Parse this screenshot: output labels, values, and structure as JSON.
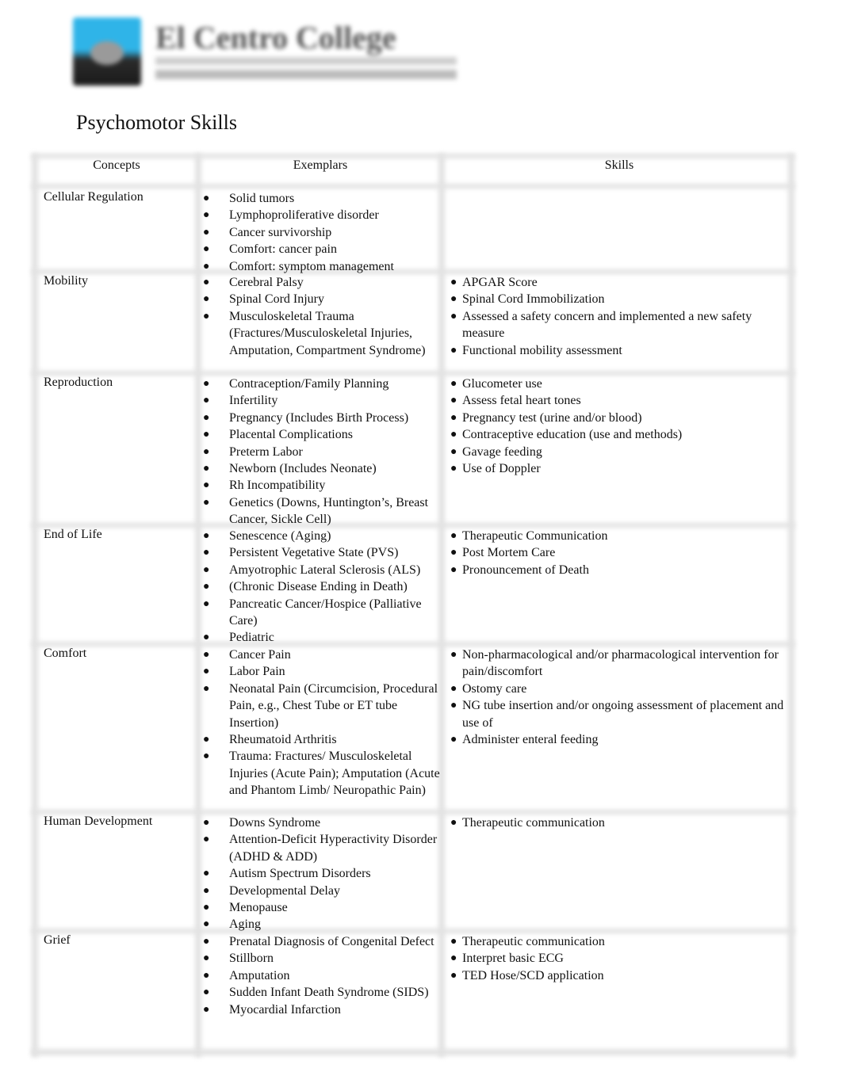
{
  "header": {
    "logo": {
      "name": "El Centro College",
      "subtitle": "DALLAS COUNTY COMMUNITY COLLEGES"
    },
    "title": "Psychomotor Skills"
  },
  "table": {
    "columns": [
      "Concepts",
      "Exemplars",
      "Skills"
    ],
    "rows": [
      {
        "concept": "Cellular Regulation",
        "exemplars": [
          "Solid tumors",
          "Lymphoproliferative disorder",
          "Cancer survivorship",
          "Comfort: cancer pain",
          "Comfort: symptom management"
        ],
        "skills": []
      },
      {
        "concept": "Mobility",
        "exemplars": [
          "Cerebral Palsy",
          "Spinal Cord Injury",
          "Musculoskeletal Trauma (Fractures/Musculoskeletal Injuries, Amputation, Compartment Syndrome)"
        ],
        "skills": [
          "APGAR Score",
          "Spinal Cord Immobilization",
          "Assessed a safety concern and implemented a  new safety measure",
          "Functional mobility assessment"
        ]
      },
      {
        "concept": "Reproduction",
        "exemplars": [
          "Contraception/Family Planning",
          "Infertility",
          "Pregnancy (Includes Birth Process)",
          "Placental Complications",
          "Preterm Labor",
          "Newborn (Includes Neonate)",
          "Rh Incompatibility",
          "Genetics (Downs, Huntington’s, Breast Cancer, Sickle Cell)"
        ],
        "skills": [
          "Glucometer use",
          "Assess fetal heart tones",
          "Pregnancy test (urine and/or blood)",
          "Contraceptive education (use and methods)",
          "Gavage feeding",
          "Use of Doppler"
        ]
      },
      {
        "concept": "End of Life",
        "exemplars": [
          "Senescence (Aging)",
          "Persistent Vegetative State (PVS)",
          "Amyotrophic Lateral Sclerosis (ALS)",
          "(Chronic Disease Ending in Death)",
          "Pancreatic Cancer/Hospice (Palliative Care)",
          "Pediatric"
        ],
        "skills": [
          "Therapeutic Communication",
          "Post Mortem Care",
          "Pronouncement of Death"
        ]
      },
      {
        "concept": "Comfort",
        "exemplars": [
          "Cancer Pain",
          "Labor Pain",
          "Neonatal Pain (Circumcision, Procedural Pain, e.g., Chest Tube or ET tube Insertion)",
          "Rheumatoid Arthritis",
          "Trauma:  Fractures/ Musculoskeletal Injuries (Acute Pain); Amputation (Acute and Phantom Limb/ Neuropathic Pain)"
        ],
        "skills": [
          "Non-pharmacological and/or pharmacological intervention for pain/discomfort",
          "Ostomy care",
          "NG tube insertion and/or ongoing assessment of placement and use of",
          "Administer enteral feeding"
        ]
      },
      {
        "concept": "Human Development",
        "exemplars": [
          "Downs Syndrome",
          "Attention-Deficit Hyperactivity Disorder (ADHD & ADD)",
          "Autism Spectrum Disorders",
          "Developmental Delay",
          "Menopause",
          "Aging"
        ],
        "skills": [
          "Therapeutic communication"
        ]
      },
      {
        "concept": "Grief",
        "exemplars": [
          "Prenatal Diagnosis of Congenital Defect",
          "Stillborn",
          "Amputation",
          "Sudden Infant Death Syndrome (SIDS)",
          "Myocardial Infarction"
        ],
        "skills": [
          "Therapeutic communication",
          "Interpret basic ECG",
          "TED Hose/SCD application"
        ]
      }
    ]
  },
  "icons": {
    "bullet": "●"
  }
}
